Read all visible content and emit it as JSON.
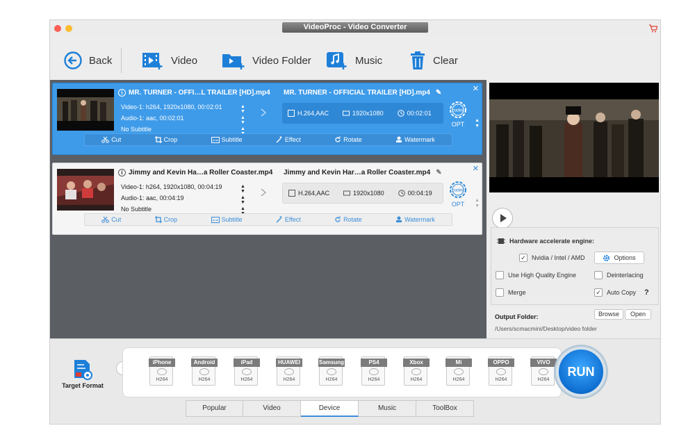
{
  "window": {
    "title": "VideoProc - Video Converter"
  },
  "toolbar": {
    "back": "Back",
    "video": "Video",
    "video_folder": "Video Folder",
    "music": "Music",
    "clear": "Clear"
  },
  "items": [
    {
      "src_title": "MR. TURNER - OFFI…L TRAILER [HD].mp4",
      "video": "Video-1: h264, 1920x1080, 00:02:01",
      "audio": "Audio-1: aac, 00:02:01",
      "subtitle": "No Subtitle",
      "dst_title": "MR. TURNER - OFFICIAL TRAILER [HD].mp4",
      "codec": "H.264,AAC",
      "resolution": "1920x1080",
      "duration": "00:02:01",
      "opt": "OPT"
    },
    {
      "src_title": "Jimmy and Kevin Ha…a Roller Coaster.mp4",
      "video": "Video-1: h264, 1920x1080, 00:04:19",
      "audio": "Audio-1: aac, 00:04:19",
      "subtitle": "No Subtitle",
      "dst_title": "Jimmy and Kevin Har…a Roller Coaster.mp4",
      "codec": "H.264,AAC",
      "resolution": "1920x1080",
      "duration": "00:04:19",
      "opt": "OPT"
    }
  ],
  "edit_tools": {
    "cut": "Cut",
    "crop": "Crop",
    "subtitle": "Subtitle",
    "effect": "Effect",
    "rotate": "Rotate",
    "watermark": "Watermark"
  },
  "settings": {
    "hw_label": "Hardware accelerate engine:",
    "nvidia": "Nvidia / Intel / AMD",
    "options": "Options",
    "hq": "Use High Quality Engine",
    "deinterlacing": "Deinterlacing",
    "merge": "Merge",
    "autocopy": "Auto Copy",
    "help": "?"
  },
  "output": {
    "label": "Output Folder:",
    "path": "/Users/scmacmini/Desktop/video folder",
    "browse": "Browse",
    "open": "Open"
  },
  "target_format": "Target Format",
  "devices": [
    {
      "name": "iPhone",
      "codec": "H264"
    },
    {
      "name": "Android",
      "codec": "H264"
    },
    {
      "name": "iPad",
      "codec": "H264"
    },
    {
      "name": "HUAWEI",
      "codec": "H264"
    },
    {
      "name": "Samsung",
      "codec": "H264"
    },
    {
      "name": "PS4",
      "codec": "H264"
    },
    {
      "name": "Xbox",
      "codec": "H264"
    },
    {
      "name": "Mi",
      "codec": "H264"
    },
    {
      "name": "OPPO",
      "codec": "H264"
    },
    {
      "name": "VIVO",
      "codec": "H264"
    }
  ],
  "tabs": [
    "Popular",
    "Video",
    "Device",
    "Music",
    "ToolBox"
  ],
  "run": "RUN",
  "colors": {
    "accent": "#3e9be9",
    "dark_list": "#5b5f64",
    "run": "#1f85e3"
  }
}
